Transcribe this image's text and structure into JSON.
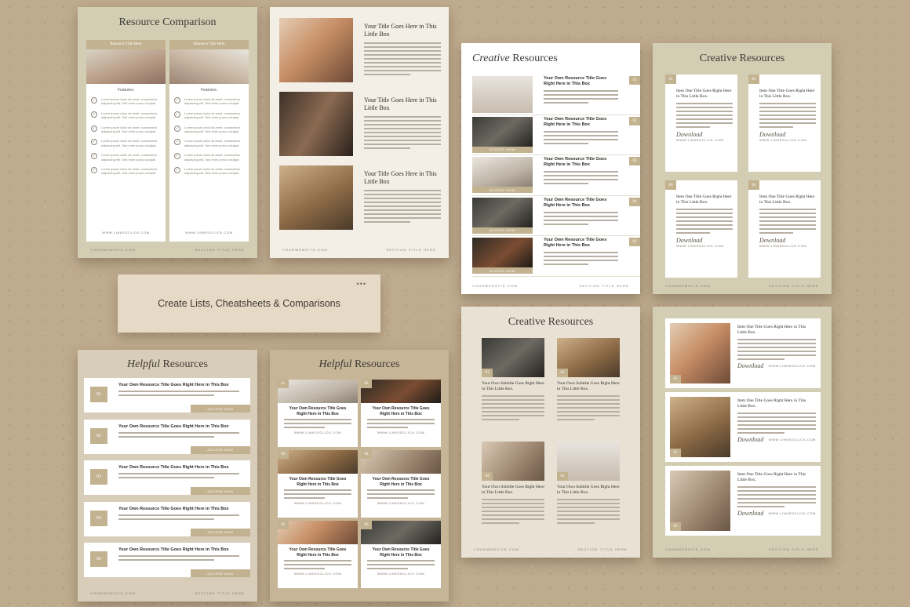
{
  "banner": {
    "text": "Create Lists, Cheatsheets & Comparisons",
    "dots": "•••"
  },
  "footer": {
    "website": "YOURWEBSITE.COM",
    "section": "SECTION TITLE HERE"
  },
  "comparison": {
    "title": "Resource Comparison",
    "columns": [
      {
        "heading": "Resource Title Here",
        "features": "Features:"
      },
      {
        "heading": "Resource Title Here",
        "features": "Features:"
      }
    ],
    "item_text": "Lorem ipsum dolor sit amet, consectetur adipiscing elit. Sed enim purus volutpat",
    "check_icon": "✓",
    "link": "WWW.LINKEDCLICK.COM"
  },
  "photo_list": {
    "items": [
      {
        "title": "Your Title Goes Here in This Little Box"
      },
      {
        "title": "Your Title Goes Here in This Little Box"
      },
      {
        "title": "Your Title Goes Here in This Little Box"
      }
    ]
  },
  "creative1": {
    "title_italic": "Creative",
    "title_rest": "Resources",
    "button": "ACCESS NOW",
    "items": [
      {
        "num": "01",
        "title": "Your Own Resource Title Goes Right Here in This Box"
      },
      {
        "num": "02",
        "title": "Your Own Resource Title Goes Right Here in This Box"
      },
      {
        "num": "03",
        "title": "Your Own Resource Title Goes Right Here in This Box"
      },
      {
        "num": "04",
        "title": "Your Own Resource Title Goes Right Here in This Box"
      },
      {
        "num": "05",
        "title": "Your Own Resource Title Goes Right Here in This Box"
      }
    ]
  },
  "creative2": {
    "title": "Creative Resources",
    "cards": [
      {
        "num": "01",
        "title": "Item One Title Goes Right Here in This Little Box.",
        "sig": "Download",
        "link": "WWW.LINKEDCLICK.COM"
      },
      {
        "num": "02",
        "title": "Item One Title Goes Right Here in This Little Box.",
        "sig": "Download",
        "link": "WWW.LINKEDCLICK.COM"
      },
      {
        "num": "03",
        "title": "Item One Title Goes Right Here in This Little Box.",
        "sig": "Download",
        "link": "WWW.LINKEDCLICK.COM"
      },
      {
        "num": "04",
        "title": "Item One Title Goes Right Here in This Little Box.",
        "sig": "Download",
        "link": "WWW.LINKEDCLICK.COM"
      }
    ]
  },
  "creative3": {
    "title": "Creative Resources",
    "cards": [
      {
        "num": "01",
        "title": "Your Own Subtitle Goes Right Here in This Little Box."
      },
      {
        "num": "02",
        "title": "Your Own Subtitle Goes Right Here in This Little Box."
      },
      {
        "num": "03",
        "title": "Your Own Subtitle Goes Right Here in This Little Box."
      },
      {
        "num": "04",
        "title": "Your Own Subtitle Goes Right Here in This Little Box."
      }
    ]
  },
  "profiles": {
    "items": [
      {
        "num": "01",
        "title": "Item One Title Goes Right Here in This Little Box.",
        "sig": "Download",
        "link": "WWW.LINKEDCLICK.COM"
      },
      {
        "num": "02",
        "title": "Item One Title Goes Right Here in This Little Box.",
        "sig": "Download",
        "link": "WWW.LINKEDCLICK.COM"
      },
      {
        "num": "03",
        "title": "Item One Title Goes Right Here in This Little Box.",
        "sig": "Download",
        "link": "WWW.LINKEDCLICK.COM"
      }
    ]
  },
  "helpful1": {
    "title_italic": "Helpful",
    "title_rest": "Resources",
    "button": "ACCESS NOW",
    "items": [
      {
        "num": "01",
        "title": "Your Own Resource Title Goes Right Here in This Box"
      },
      {
        "num": "02",
        "title": "Your Own Resource Title Goes Right Here in This Box"
      },
      {
        "num": "03",
        "title": "Your Own Resource Title Goes Right Here in This Box"
      },
      {
        "num": "04",
        "title": "Your Own Resource Title Goes Right Here in This Box"
      },
      {
        "num": "05",
        "title": "Your Own Resource Title Goes Right Here in This Box"
      }
    ]
  },
  "helpful2": {
    "title_italic": "Helpful",
    "title_rest": "Resources",
    "link": "WWW.LINKEDCLICK.COM",
    "cards": [
      {
        "num": "01",
        "title": "Your Own Resource Title Goes Right Here in This Box"
      },
      {
        "num": "02",
        "title": "Your Own Resource Title Goes Right Here in This Box"
      },
      {
        "num": "03",
        "title": "Your Own Resource Title Goes Right Here in This Box"
      },
      {
        "num": "04",
        "title": "Your Own Resource Title Goes Right Here in This Box"
      },
      {
        "num": "05",
        "title": "Your Own Resource Title Goes Right Here in This Box"
      },
      {
        "num": "06",
        "title": "Your Own Resource Title Goes Right Here in This Box"
      }
    ]
  },
  "colors": {
    "background": "#bfab8e",
    "accent": "#c3b290",
    "page_sage": "#d3cdb4",
    "page_cream": "#f3eee6"
  }
}
